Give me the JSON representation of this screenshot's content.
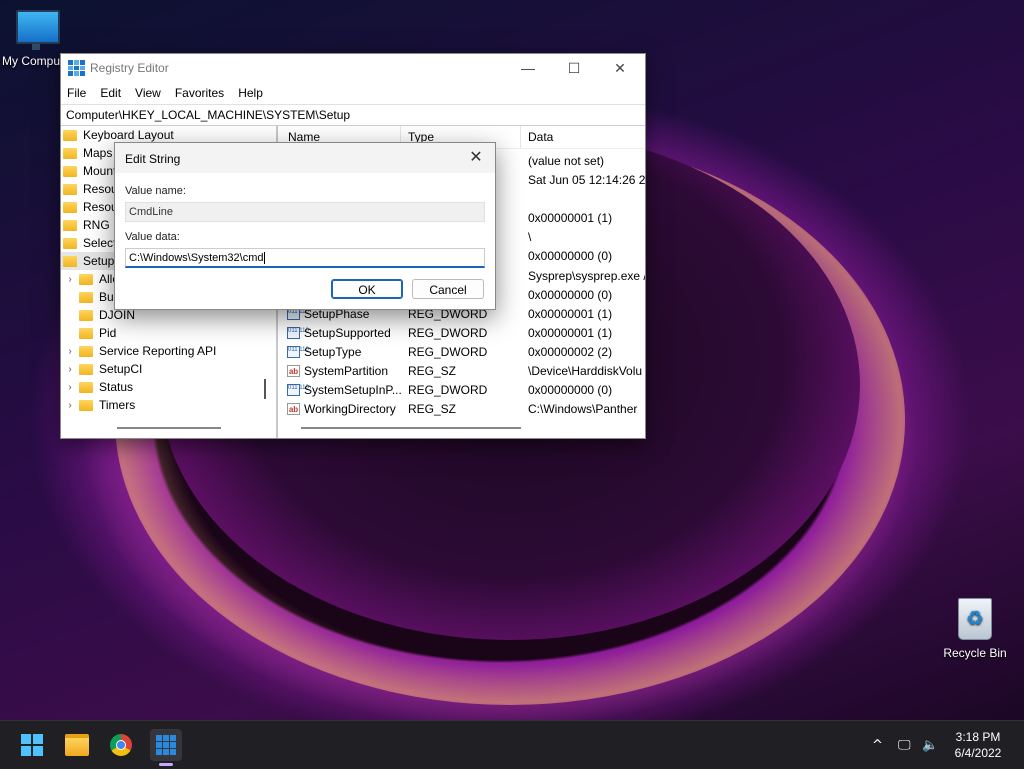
{
  "desktop": {
    "icons": [
      {
        "label": "My Compu"
      },
      {
        "label": "Recycle Bin"
      }
    ]
  },
  "window": {
    "title": "Registry Editor",
    "menu": [
      "File",
      "Edit",
      "View",
      "Favorites",
      "Help"
    ],
    "address": "Computer\\HKEY_LOCAL_MACHINE\\SYSTEM\\Setup",
    "tree": [
      {
        "label": "Keyboard Layout",
        "indent": 0,
        "expander": false
      },
      {
        "label": "Maps",
        "indent": 0,
        "expander": false
      },
      {
        "label": "Mount",
        "indent": 0,
        "expander": false
      },
      {
        "label": "Resour",
        "indent": 0,
        "expander": false
      },
      {
        "label": "Resour",
        "indent": 0,
        "expander": false
      },
      {
        "label": "RNG",
        "indent": 0,
        "expander": false
      },
      {
        "label": "Select",
        "indent": 0,
        "expander": false
      },
      {
        "label": "Setup",
        "indent": 0,
        "expander": false,
        "selected": true
      },
      {
        "label": "Allo",
        "indent": 1,
        "expander": true
      },
      {
        "label": "Buil",
        "indent": 1,
        "expander": false
      },
      {
        "label": "DJOIN",
        "indent": 1,
        "expander": false
      },
      {
        "label": "Pid",
        "indent": 1,
        "expander": false
      },
      {
        "label": "Service Reporting API",
        "indent": 1,
        "expander": true
      },
      {
        "label": "SetupCI",
        "indent": 1,
        "expander": true
      },
      {
        "label": "Status",
        "indent": 1,
        "expander": true
      },
      {
        "label": "Timers",
        "indent": 1,
        "expander": true
      }
    ],
    "columns": {
      "name": "Name",
      "type": "Type",
      "data": "Data"
    },
    "values": [
      {
        "name": "",
        "type": "",
        "data": "(value not set)",
        "icon": "none"
      },
      {
        "name": "",
        "type": "",
        "data": "Sat Jun 05 12:14:26 202",
        "icon": "none"
      },
      {
        "name": "",
        "type": "",
        "data": "0x00000001 (1)",
        "icon": "none"
      },
      {
        "name": "",
        "type": "",
        "data": "\\",
        "icon": "none"
      },
      {
        "name": "",
        "type": "",
        "data": "0x00000000 (0)",
        "icon": "none"
      },
      {
        "name": "",
        "type": "",
        "data": "Sysprep\\sysprep.exe /",
        "icon": "none"
      },
      {
        "name": "",
        "type": "",
        "data": "0x00000000 (0)",
        "icon": "none"
      },
      {
        "name": "SetupPhase",
        "type": "REG_DWORD",
        "data": "0x00000001 (1)",
        "icon": "num"
      },
      {
        "name": "SetupSupported",
        "type": "REG_DWORD",
        "data": "0x00000001 (1)",
        "icon": "num"
      },
      {
        "name": "SetupType",
        "type": "REG_DWORD",
        "data": "0x00000002 (2)",
        "icon": "num"
      },
      {
        "name": "SystemPartition",
        "type": "REG_SZ",
        "data": "\\Device\\HarddiskVolu",
        "icon": "str"
      },
      {
        "name": "SystemSetupInP...",
        "type": "REG_DWORD",
        "data": "0x00000000 (0)",
        "icon": "num"
      },
      {
        "name": "WorkingDirectory",
        "type": "REG_SZ",
        "data": "C:\\Windows\\Panther",
        "icon": "str"
      }
    ]
  },
  "dialog": {
    "title": "Edit String",
    "value_name_label": "Value name:",
    "value_name": "CmdLine",
    "value_data_label": "Value data:",
    "value_data": "C:\\Windows\\System32\\cmd",
    "ok_label": "OK",
    "cancel_label": "Cancel",
    "close_glyph": "✕"
  },
  "taskbar": {
    "time": "3:18 PM",
    "date": "6/4/2022",
    "tray_chevron": "^",
    "accent": "#4cc2ff"
  }
}
